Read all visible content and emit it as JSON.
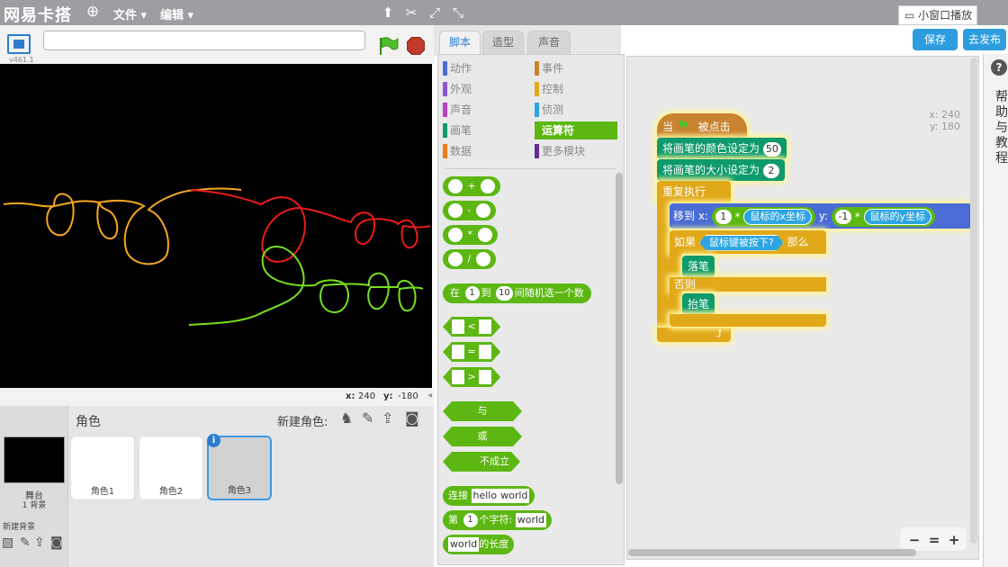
{
  "app": {
    "logo": "网易卡搭",
    "menu_file": "文件 ▾",
    "menu_edit": "编辑 ▾",
    "mini_play": "小窗口播放"
  },
  "stage": {
    "version": "v461.1",
    "coord_x_label": "x:",
    "coord_x": "240",
    "coord_y_label": "y:",
    "coord_y": "-180"
  },
  "sprites": {
    "title": "角色",
    "new_sprite": "新建角色:",
    "stage_label": "舞台",
    "stage_backdrops": "1 背景",
    "new_backdrop": "新建背景",
    "items": [
      {
        "name": "角色1"
      },
      {
        "name": "角色2"
      },
      {
        "name": "角色3"
      }
    ]
  },
  "tabs": [
    {
      "label": "脚本"
    },
    {
      "label": "造型"
    },
    {
      "label": "声音"
    }
  ],
  "categories": [
    {
      "label": "动作",
      "color": "#4a6cd4"
    },
    {
      "label": "事件",
      "color": "#c88330"
    },
    {
      "label": "外观",
      "color": "#8a55d7"
    },
    {
      "label": "控制",
      "color": "#e1a91a"
    },
    {
      "label": "声音",
      "color": "#bb42c3"
    },
    {
      "label": "侦测",
      "color": "#2ca5e2"
    },
    {
      "label": "画笔",
      "color": "#0e9a6c"
    },
    {
      "label": "运算符",
      "color": "#5cb712"
    },
    {
      "label": "数据",
      "color": "#ee7d16"
    },
    {
      "label": "更多模块",
      "color": "#632d99"
    }
  ],
  "palette": {
    "add": "+",
    "sub": "-",
    "mul": "*",
    "div": "/",
    "random_pre": "在",
    "random_a": "1",
    "random_mid": "到",
    "random_b": "10",
    "random_post": "间随机选一个数",
    "lt": "<",
    "eq": "=",
    "gt": ">",
    "and": "与",
    "or": "或",
    "not": "不成立",
    "join": "连接",
    "join_a": "hello",
    "join_b": "world",
    "letter_pre": "第",
    "letter_n": "1",
    "letter_mid": "个字符:",
    "letter_s": "world",
    "length_s": "world",
    "length_post": "的长度"
  },
  "script": {
    "coord_x": "x: 240",
    "coord_y": "y: 180",
    "hat_pre": "当",
    "hat_post": "被点击",
    "set_color": "将画笔的颜色设定为",
    "color_val": "50",
    "set_size": "将画笔的大小设定为",
    "size_val": "2",
    "forever": "重复执行",
    "goto": "移到 x:",
    "mul_a": "1",
    "mul_op": "*",
    "mouse_x": "鼠标的x坐标",
    "goto_y": "y:",
    "mul_b": "-1",
    "mouse_y": "鼠标的y坐标",
    "if": "如果",
    "mouse_down": "鼠标键被按下?",
    "then": "那么",
    "pen_down": "落笔",
    "else": "否则",
    "pen_up": "抬笔"
  },
  "buttons": {
    "save": "保存",
    "publish": "去发布"
  },
  "help": {
    "q": "?",
    "text": "帮助与教程"
  },
  "zoom": {
    "out": "−",
    "reset": "=",
    "in": "+"
  }
}
